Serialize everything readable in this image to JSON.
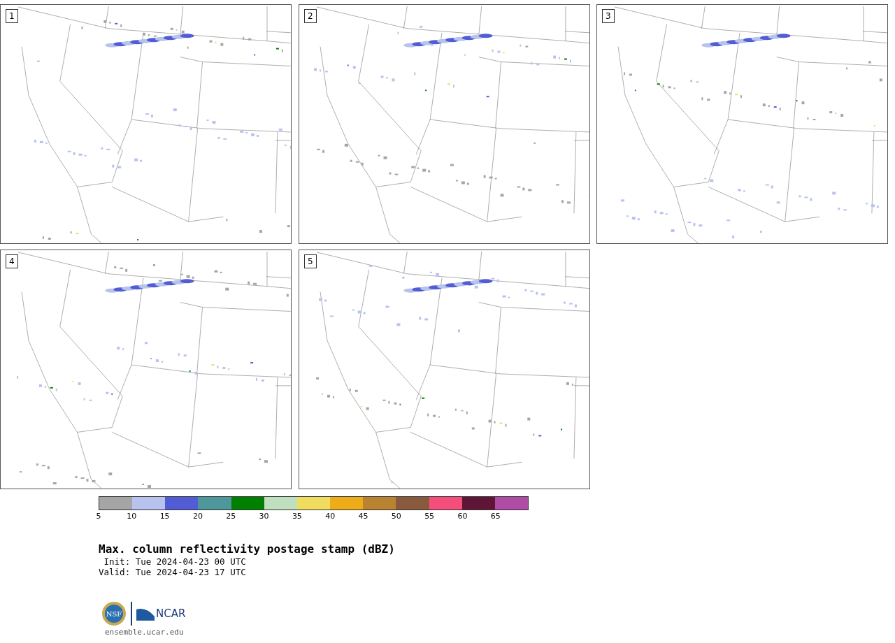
{
  "panels": [
    {
      "label": "1"
    },
    {
      "label": "2"
    },
    {
      "label": "3"
    },
    {
      "label": "4"
    },
    {
      "label": "5"
    }
  ],
  "colorbar": {
    "bins": [
      {
        "color": "#a5a5a5",
        "label": "5"
      },
      {
        "color": "#b7c3ee",
        "label": "10"
      },
      {
        "color": "#525dd5",
        "label": "15"
      },
      {
        "color": "#4e979b",
        "label": "20"
      },
      {
        "color": "#008000",
        "label": "25"
      },
      {
        "color": "#bfdfbf",
        "label": "30"
      },
      {
        "color": "#f0dc5e",
        "label": "35"
      },
      {
        "color": "#efac19",
        "label": "40"
      },
      {
        "color": "#b98431",
        "label": "45"
      },
      {
        "color": "#8a5a3e",
        "label": "50"
      },
      {
        "color": "#f44f7c",
        "label": "55"
      },
      {
        "color": "#5f1536",
        "label": "60"
      },
      {
        "color": "#b04ca5",
        "label": "65"
      }
    ]
  },
  "title": "Max. column reflectivity postage stamp (dBZ)",
  "init": " Init: Tue 2024-04-23 00 UTC",
  "valid": "Valid: Tue 2024-04-23 17 UTC",
  "logo": {
    "nsf": "NSF",
    "ncar": "NCAR"
  },
  "url": "ensemble.ucar.edu"
}
